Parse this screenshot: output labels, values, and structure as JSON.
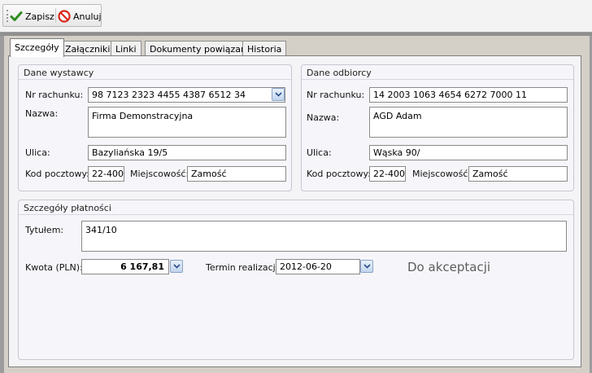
{
  "toolbar": {
    "save_label": "Zapisz",
    "cancel_label": "Anuluj"
  },
  "tabs": [
    {
      "label": "Szczegóły",
      "active": true
    },
    {
      "label": "Załączniki",
      "active": false
    },
    {
      "label": "Linki",
      "active": false
    },
    {
      "label": "Dokumenty powiązane",
      "active": false
    },
    {
      "label": "Historia",
      "active": false
    }
  ],
  "sender": {
    "title": "Dane wystawcy",
    "account_label": "Nr rachunku:",
    "account_value": "98 7123 2323 4455 4387 6512 34",
    "name_label": "Nazwa:",
    "name_value": "Firma Demonstracyjna",
    "street_label": "Ulica:",
    "street_value": "Bazyliańska 19/5",
    "postcode_label": "Kod pocztowy:",
    "postcode_value": "22-400",
    "city_label": "Miejscowość:",
    "city_value": "Zamość"
  },
  "recipient": {
    "title": "Dane odbiorcy",
    "account_label": "Nr rachunku:",
    "account_value": "14 2003 1063 4654 6272 7000 11",
    "name_label": "Nazwa:",
    "name_value": "AGD Adam",
    "street_label": "Ulica:",
    "street_value": "Wąska 90/",
    "postcode_label": "Kod pocztowy:",
    "postcode_value": "22-400",
    "city_label": "Miejscowość:",
    "city_value": "Zamość"
  },
  "payment": {
    "title": "Szczegóły płatności",
    "title_label": "Tytułem:",
    "title_value": "341/10",
    "amount_label": "Kwota (PLN):",
    "amount_value": "6 167,81",
    "due_label": "Termin realizacji:",
    "due_value": "2012-06-20",
    "status": "Do akceptacji"
  },
  "icons": {
    "save": "check-icon",
    "cancel": "no-entry-icon",
    "dropdown": "chevron-down-icon"
  }
}
